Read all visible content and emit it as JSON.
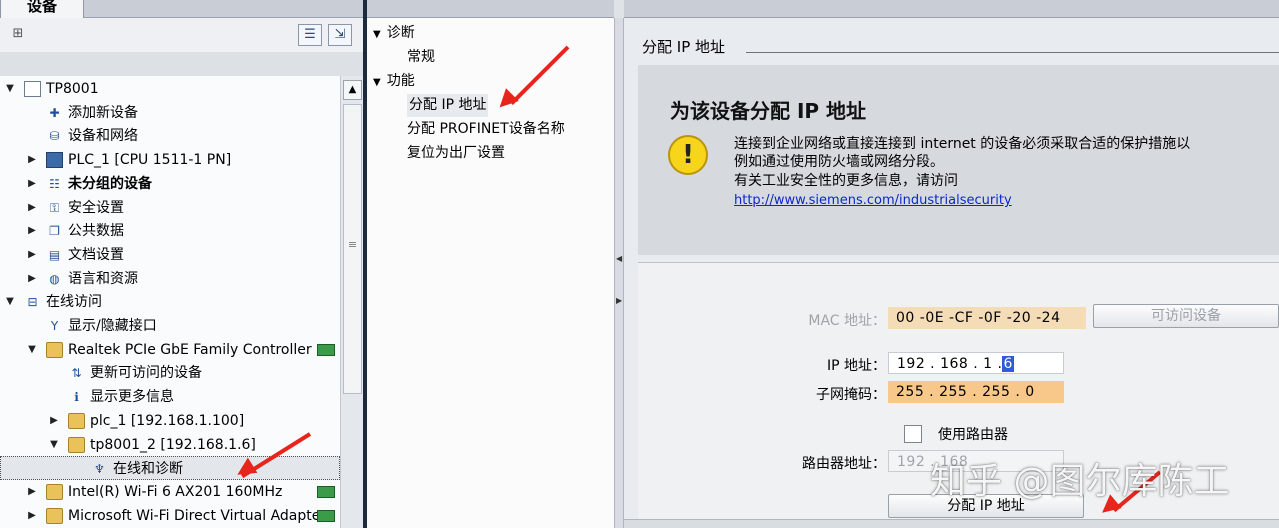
{
  "left_panel": {
    "tab_label": "设备",
    "tree": [
      {
        "label": "TP8001",
        "level": 0,
        "arrow": "▼",
        "icon": "doc-icon"
      },
      {
        "label": "添加新设备",
        "level": 1,
        "arrow": "",
        "icon": "add-device-icon"
      },
      {
        "label": "设备和网络",
        "level": 1,
        "arrow": "",
        "icon": "network-icon"
      },
      {
        "label": "PLC_1 [CPU 1511-1 PN]",
        "level": 1,
        "arrow": "▶",
        "icon": "plc-icon"
      },
      {
        "label": "未分组的设备",
        "level": 1,
        "arrow": "▶",
        "icon": "ungrouped-icon",
        "bold": true
      },
      {
        "label": "安全设置",
        "level": 1,
        "arrow": "▶",
        "icon": "security-icon"
      },
      {
        "label": "公共数据",
        "level": 1,
        "arrow": "▶",
        "icon": "common-data-icon"
      },
      {
        "label": "文档设置",
        "level": 1,
        "arrow": "▶",
        "icon": "document-icon"
      },
      {
        "label": "语言和资源",
        "level": 1,
        "arrow": "▶",
        "icon": "language-icon"
      },
      {
        "label": "在线访问",
        "level": 0,
        "arrow": "▼",
        "icon": "online-access-icon"
      },
      {
        "label": "显示/隐藏接口",
        "level": 1,
        "arrow": "",
        "icon": "interface-icon"
      },
      {
        "label": "Realtek PCIe GbE Family Controller",
        "level": 1,
        "arrow": "▼",
        "icon": "folder-icon",
        "net": true
      },
      {
        "label": "更新可访问的设备",
        "level": 2,
        "arrow": "",
        "icon": "update-icon"
      },
      {
        "label": "显示更多信息",
        "level": 2,
        "arrow": "",
        "icon": "info-icon"
      },
      {
        "label": "plc_1 [192.168.1.100]",
        "level": 2,
        "arrow": "▶",
        "icon": "folder-icon"
      },
      {
        "label": "tp8001_2 [192.168.1.6]",
        "level": 2,
        "arrow": "▼",
        "icon": "folder-icon"
      },
      {
        "label": "在线和诊断",
        "level": 3,
        "arrow": "",
        "icon": "diagnostics-icon",
        "selected": true
      },
      {
        "label": "Intel(R) Wi-Fi 6 AX201 160MHz",
        "level": 1,
        "arrow": "▶",
        "icon": "folder-icon",
        "net": true
      },
      {
        "label": "Microsoft Wi-Fi Direct Virtual Adapter",
        "level": 1,
        "arrow": "▶",
        "icon": "folder-icon",
        "net": true
      }
    ]
  },
  "nav_panel": {
    "items": [
      {
        "label": "诊断",
        "arrow": "▼",
        "level": 0
      },
      {
        "label": "常规",
        "arrow": "",
        "level": 1
      },
      {
        "label": "功能",
        "arrow": "▼",
        "level": 0
      },
      {
        "label": "分配 IP 地址",
        "arrow": "",
        "level": 1,
        "selected": true
      },
      {
        "label": "分配 PROFINET设备名称",
        "arrow": "",
        "level": 1
      },
      {
        "label": "复位为出厂设置",
        "arrow": "",
        "level": 1
      }
    ]
  },
  "content": {
    "section_title": "分配 IP 地址",
    "heading": "为该设备分配 IP 地址",
    "warning_lines": [
      "连接到企业网络或直接连接到 internet 的设备必须采取合适的保护措施以",
      "例如通过使用防火墙或网络分段。",
      "有关工业安全性的更多信息，请访问"
    ],
    "link": "http://www.siemens.com/industrialsecurity",
    "mac_label": "MAC 地址：",
    "mac_value": "00 -0E -CF -0F -20 -24",
    "accessible_devices_button": "可访问设备",
    "ip_label": "IP 地址：",
    "ip_value_prefix": "192 . 168 . 1   .",
    "ip_value_cursor": "6",
    "mask_label": "子网掩码：",
    "mask_value": "255 . 255 . 255 . 0",
    "use_router_label": "使用路由器",
    "router_label": "路由器地址：",
    "router_value": "192 . 168",
    "assign_button": "分配 IP 地址"
  },
  "watermark": "知乎 @图尔库陈工",
  "colors": {
    "annotation_arrow": "#e8251d",
    "mac_field_bg": "#f4dcb6",
    "mask_field_bg": "#f7c88a",
    "warning_icon": "#f6d51a",
    "link": "#0b28c8"
  }
}
